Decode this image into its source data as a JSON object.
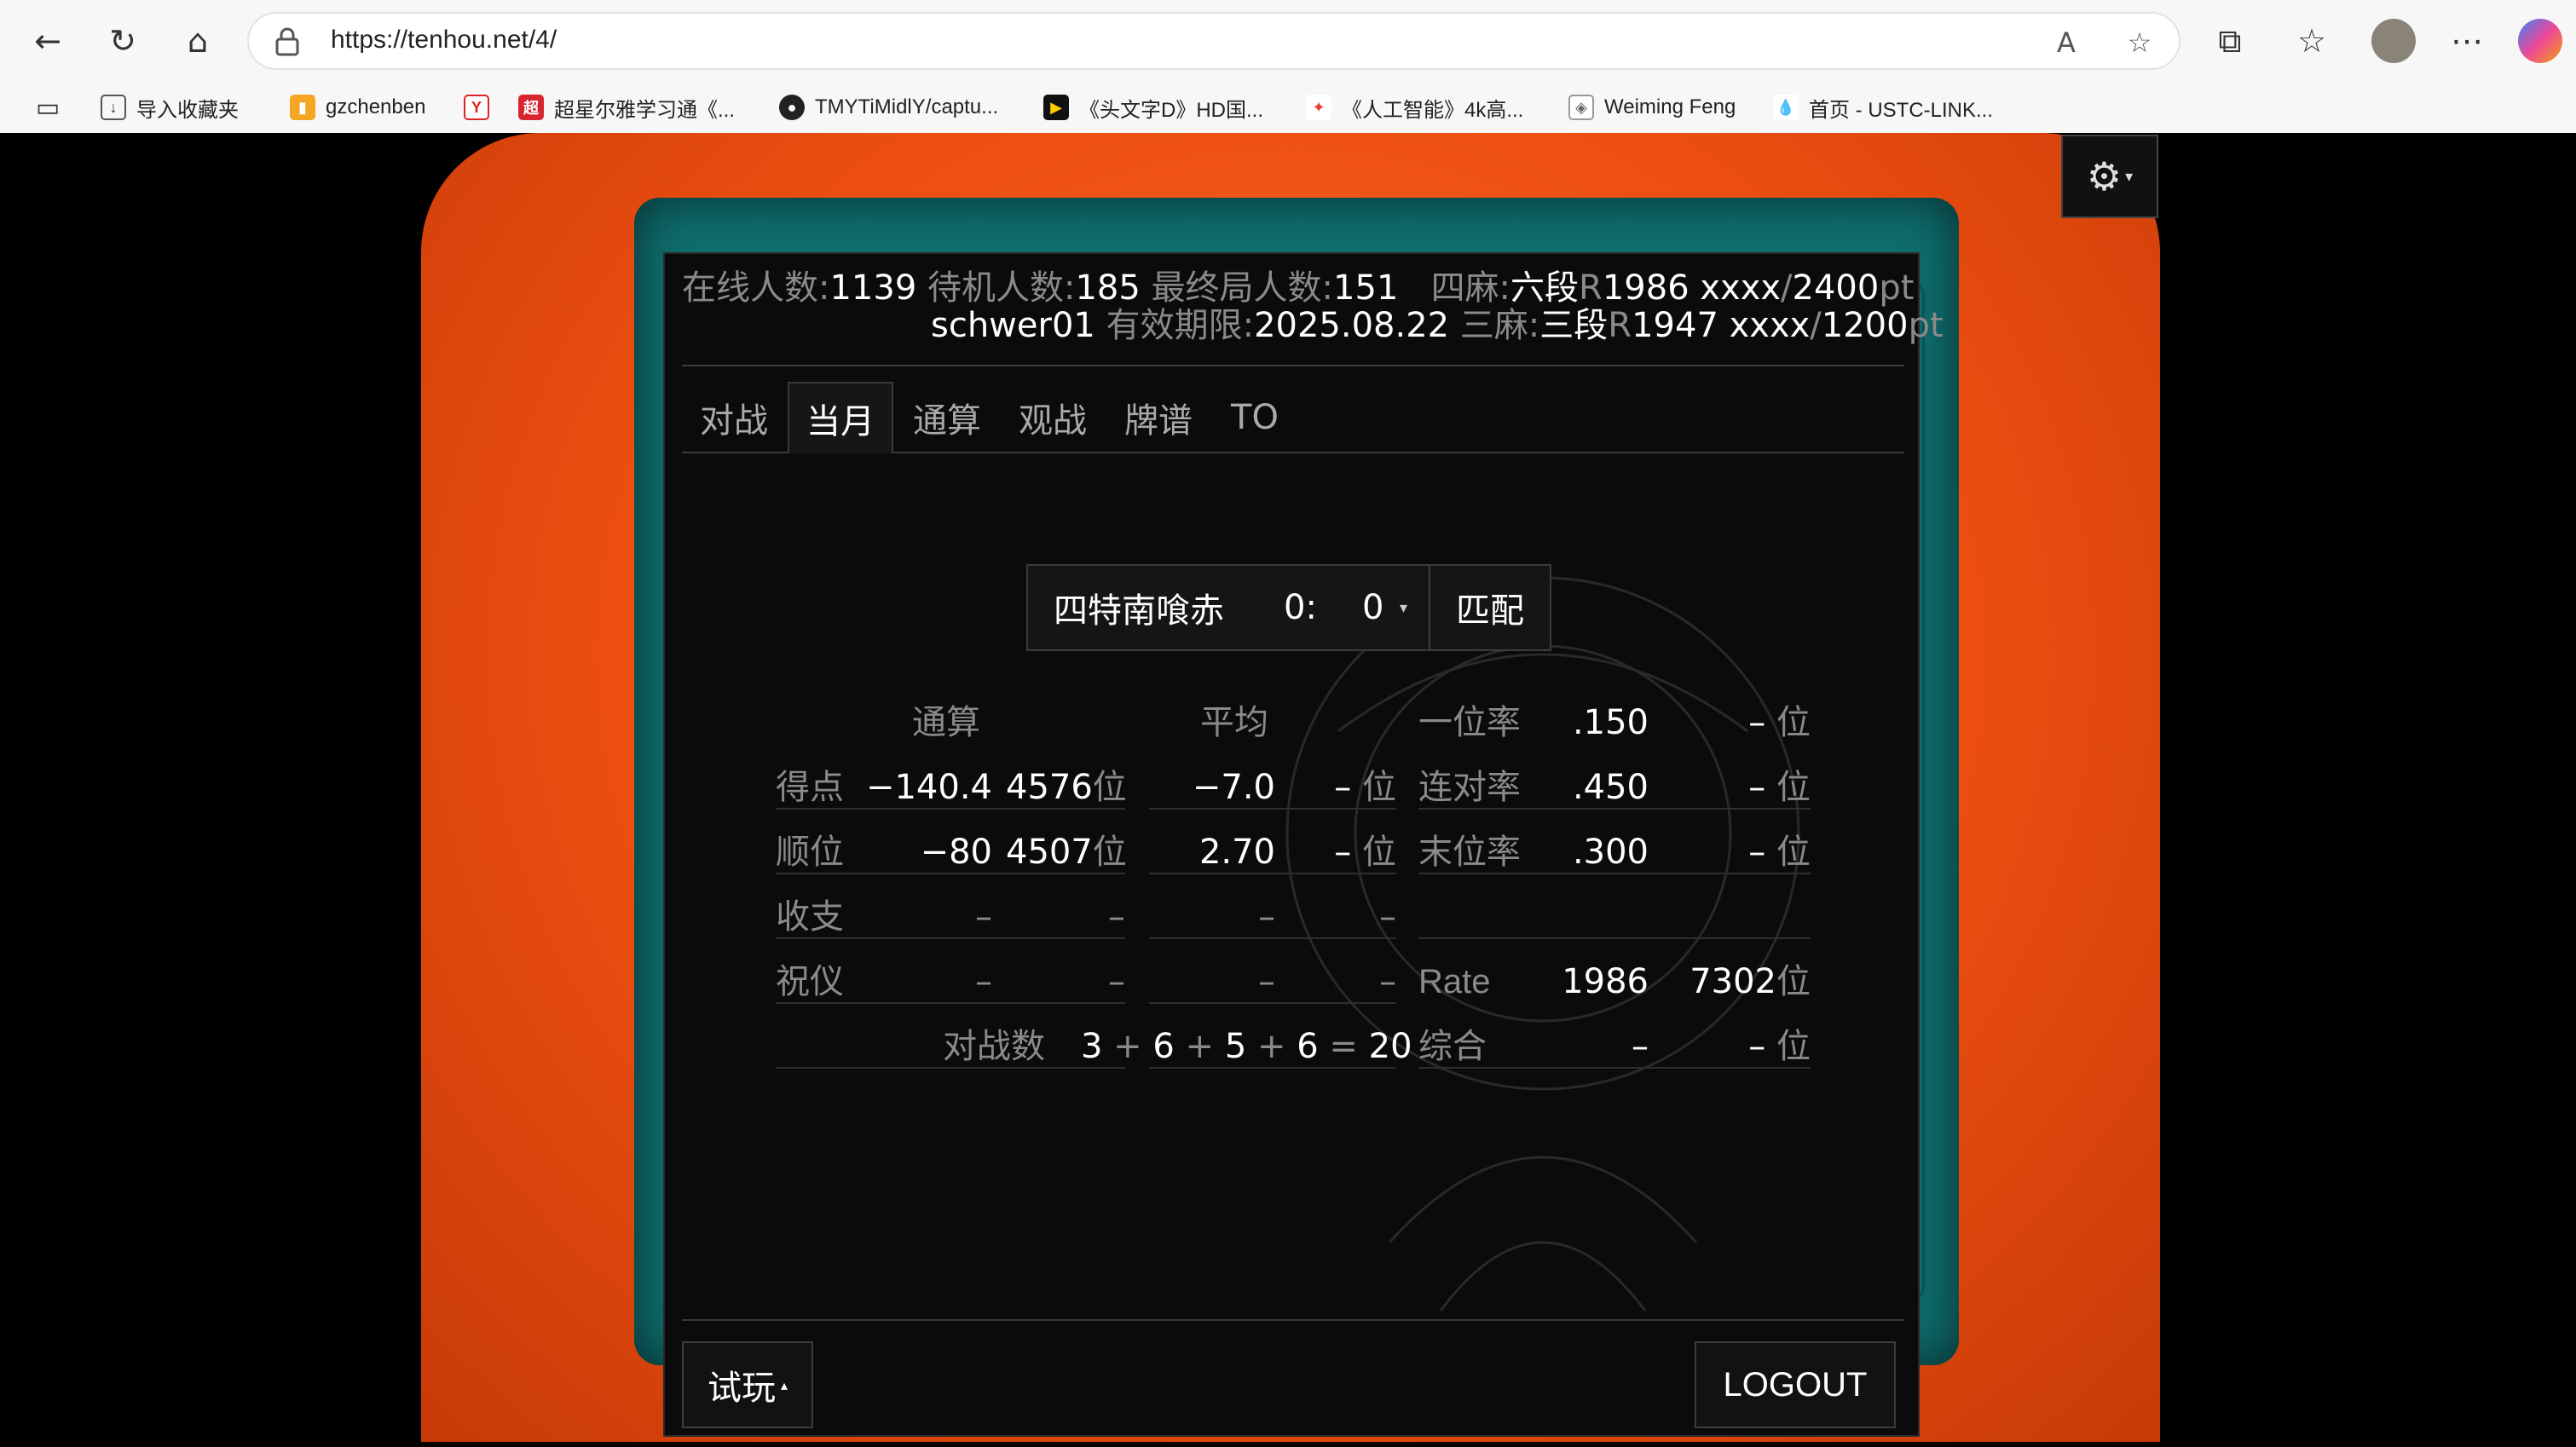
{
  "browser": {
    "url": "https://tenhou.net/4/",
    "bookmarks": [
      {
        "label": "导入收藏夹",
        "icon": "folder-import-icon"
      },
      {
        "label": "gzchenben",
        "icon": "chart-icon"
      },
      {
        "label": "",
        "icon": "y-icon"
      },
      {
        "label": "超星尔雅学习通《...",
        "icon": "chaoxing-icon"
      },
      {
        "label": "TMYTiMidlY/captu...",
        "icon": "github-icon"
      },
      {
        "label": "《头文字D》HD国...",
        "icon": "video-icon"
      },
      {
        "label": "《人工智能》4k高...",
        "icon": "bilibili-icon"
      },
      {
        "label": "Weiming Feng",
        "icon": "website-icon"
      },
      {
        "label": "首页 - USTC-LINK...",
        "icon": "drop-icon"
      }
    ]
  },
  "header": {
    "online_label": "在线人数:",
    "online": "1139",
    "waiting_label": "待机人数:",
    "waiting": "185",
    "final_label": "最终局人数:",
    "final": "151",
    "four_label": "四麻:",
    "four_rank": "六段",
    "four_r": "R",
    "four_rate": "1986 xxxx",
    "slash": "/",
    "four_pt": "2400",
    "pt": "pt",
    "user": "schwer01",
    "expiry_label": "有效期限:",
    "expiry": "2025.08.22",
    "three_label": "三麻:",
    "three_rank": "三段",
    "three_r": "R",
    "three_rate": "1947 xxxx",
    "three_pt": "1200"
  },
  "tabs": [
    "对战",
    "当月",
    "通算",
    "观战",
    "牌谱",
    "TO"
  ],
  "match": {
    "rule": "四特南喰赤",
    "score": "0:",
    "count": "0",
    "button": "匹配"
  },
  "stats": {
    "col_total": "通算",
    "col_avg": "平均",
    "rows": [
      {
        "label": "得点",
        "total": "−140.4",
        "total_rank": "4576",
        "avg": "−7.0",
        "avg_rank": "–"
      },
      {
        "label": "顺位",
        "total": "−80",
        "total_rank": "4507",
        "avg": "2.70",
        "avg_rank": "–"
      },
      {
        "label": "收支",
        "total": "–",
        "total_rank": "–",
        "avg": "–",
        "avg_rank": "–"
      },
      {
        "label": "祝仪",
        "total": "–",
        "total_rank": "–",
        "avg": "–",
        "avg_rank": "–"
      }
    ],
    "rank_unit": "位",
    "right": [
      {
        "label": "一位率",
        "value": ".150",
        "rank": "–"
      },
      {
        "label": "连对率",
        "value": ".450",
        "rank": "–"
      },
      {
        "label": "末位率",
        "value": ".300",
        "rank": "–"
      },
      {
        "label": "Rate",
        "value": "1986",
        "rank": "7302"
      },
      {
        "label": "综合",
        "value": "–",
        "rank": "–"
      }
    ],
    "games_label": "对战数",
    "games": [
      "3",
      "+",
      "6",
      "+",
      "5",
      "+",
      "6",
      "=",
      "20"
    ]
  },
  "footer": {
    "trial": "试玩",
    "logout": "LOGOUT"
  }
}
